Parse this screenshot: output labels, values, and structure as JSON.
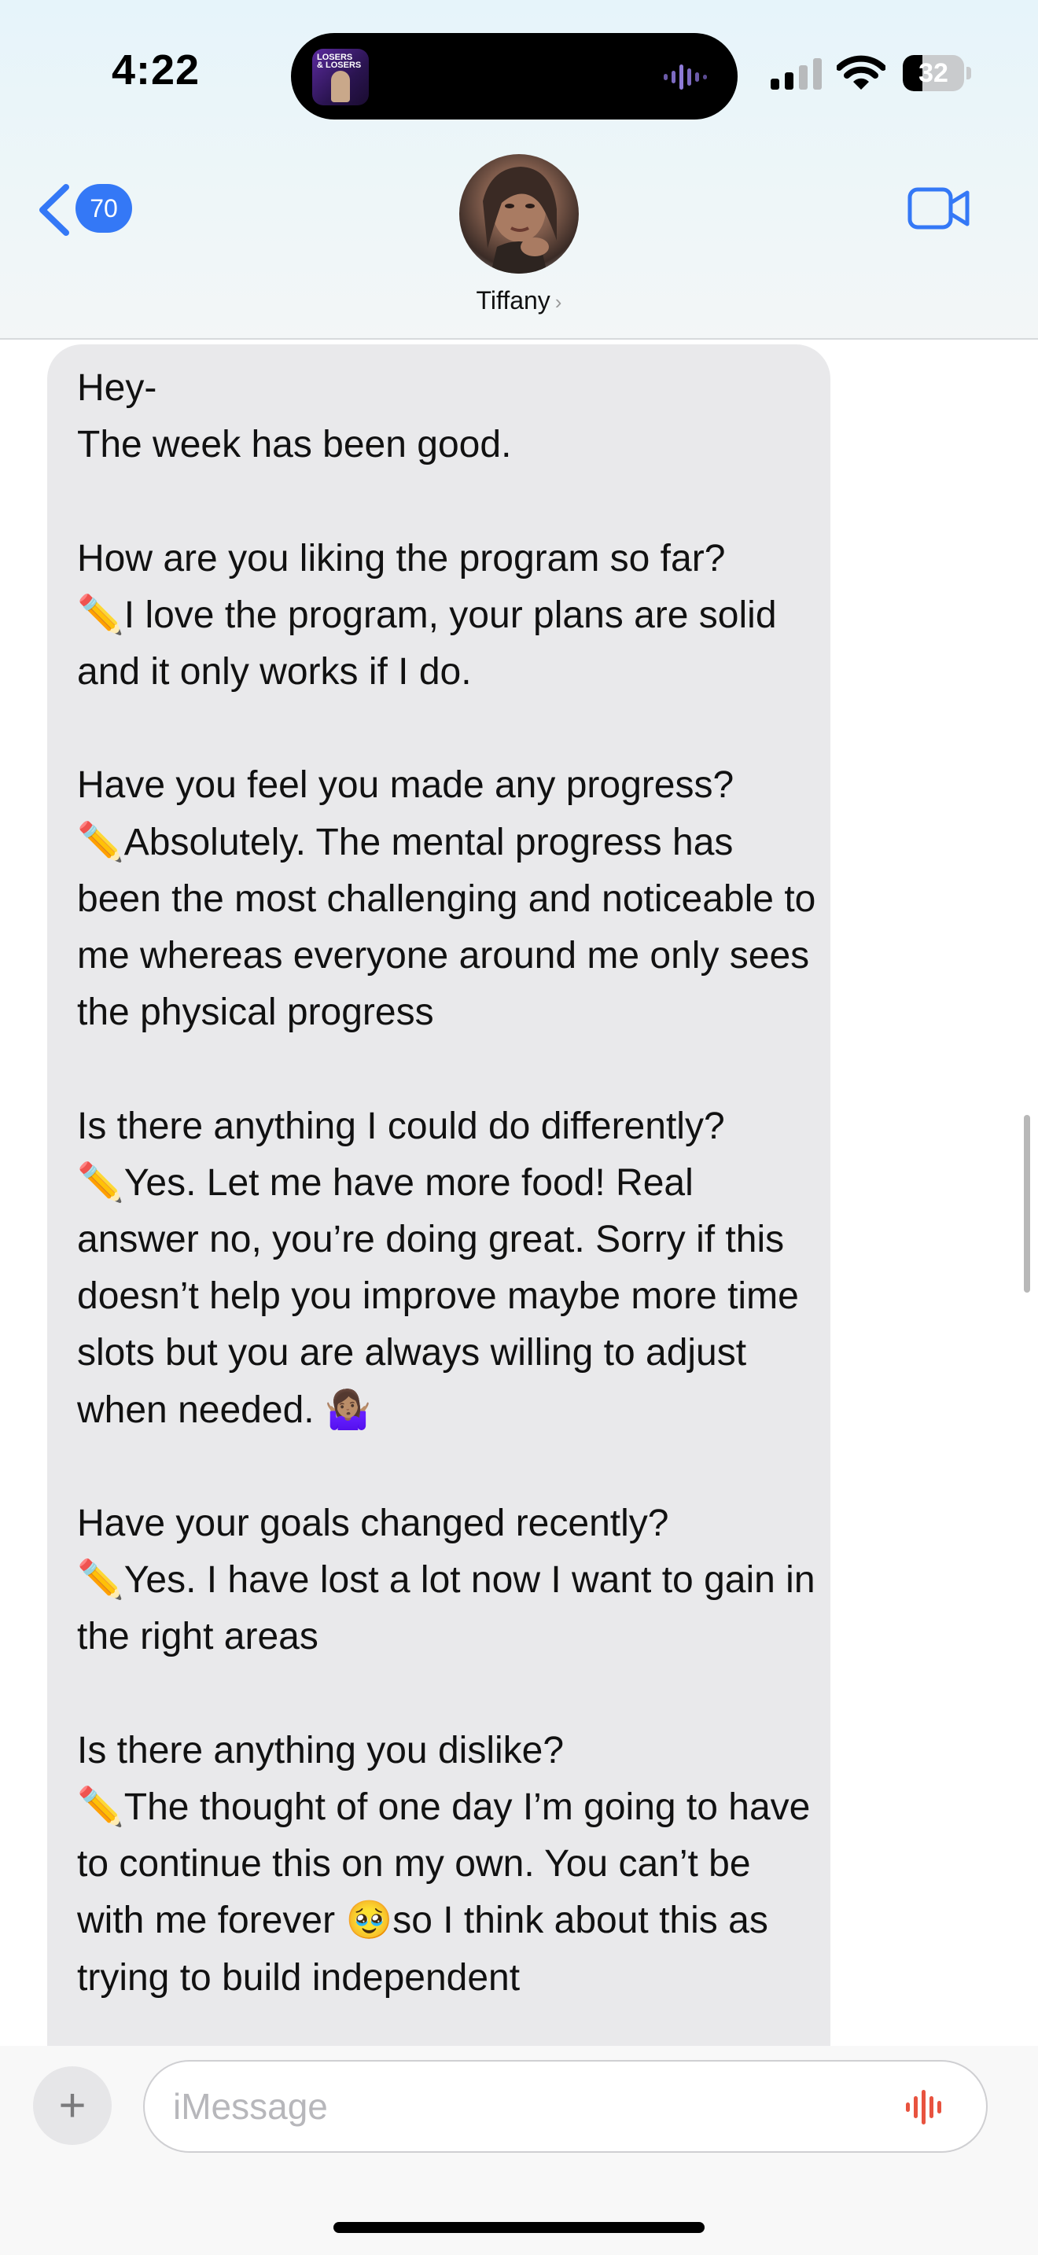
{
  "status_bar": {
    "time": "4:22",
    "battery": "32",
    "battery_level": 0.32
  },
  "header": {
    "back_count": "70",
    "contact_name": "Tiffany",
    "contact_chevron": "›"
  },
  "message": {
    "paragraphs": [
      "Hey-\nThe week has been good.",
      "How are you liking the program so far?\n✏️I love the program, your plans are solid and it only works if I do.",
      "Have you feel you made any progress?\n✏️Absolutely. The mental progress has been the most challenging and noticeable to me whereas everyone around me only sees the physical progress",
      "Is there anything I could do differently?\n✏️Yes. Let me have more food! Real answer no, you’re doing great. Sorry if this doesn’t help you improve maybe more time slots but you are always willing to adjust when needed. 🤷🏽‍♀️",
      "Have your goals changed recently?\n✏️Yes. I have lost a lot now I want to gain in the right areas",
      "Is there anything you dislike?\n✏️The thought of one day I’m going to have to continue this on my own. You can’t be with me forever 🥹so I think about this as trying to build independent"
    ]
  },
  "composer": {
    "plus_label": "+",
    "placeholder": "iMessage"
  },
  "colors": {
    "accent": "#3478f6",
    "bubble": "#e9e9eb",
    "mic": "#e8533f"
  }
}
